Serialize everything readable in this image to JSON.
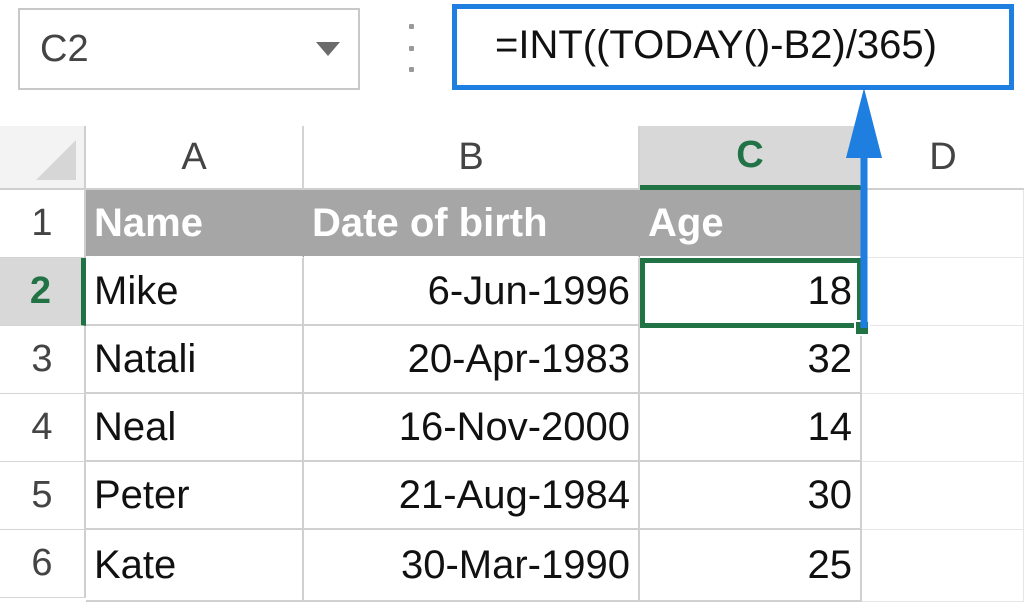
{
  "name_box": {
    "value": "C2"
  },
  "formula_bar": {
    "value": "=INT((TODAY()-B2)/365)"
  },
  "columns": [
    "A",
    "B",
    "C",
    "D"
  ],
  "active_column": "C",
  "rows": [
    "1",
    "2",
    "3",
    "4",
    "5",
    "6"
  ],
  "active_row": "2",
  "table": {
    "headers": [
      "Name",
      "Date of birth",
      "Age"
    ],
    "data": [
      [
        "Mike",
        "6-Jun-1996",
        "18"
      ],
      [
        "Natali",
        "20-Apr-1983",
        "32"
      ],
      [
        "Neal",
        "16-Nov-2000",
        "14"
      ],
      [
        "Peter",
        "21-Aug-1984",
        "30"
      ],
      [
        "Kate",
        "30-Mar-1990",
        "25"
      ]
    ]
  },
  "colors": {
    "accent_green": "#217346",
    "arrow_blue": "#1e7fe0",
    "header_fill": "#a6a6a6"
  },
  "icons": {
    "name_box_dropdown": "chevron-down-icon",
    "menu": "vertical-dots-icon",
    "annotation": "up-arrow-icon"
  }
}
